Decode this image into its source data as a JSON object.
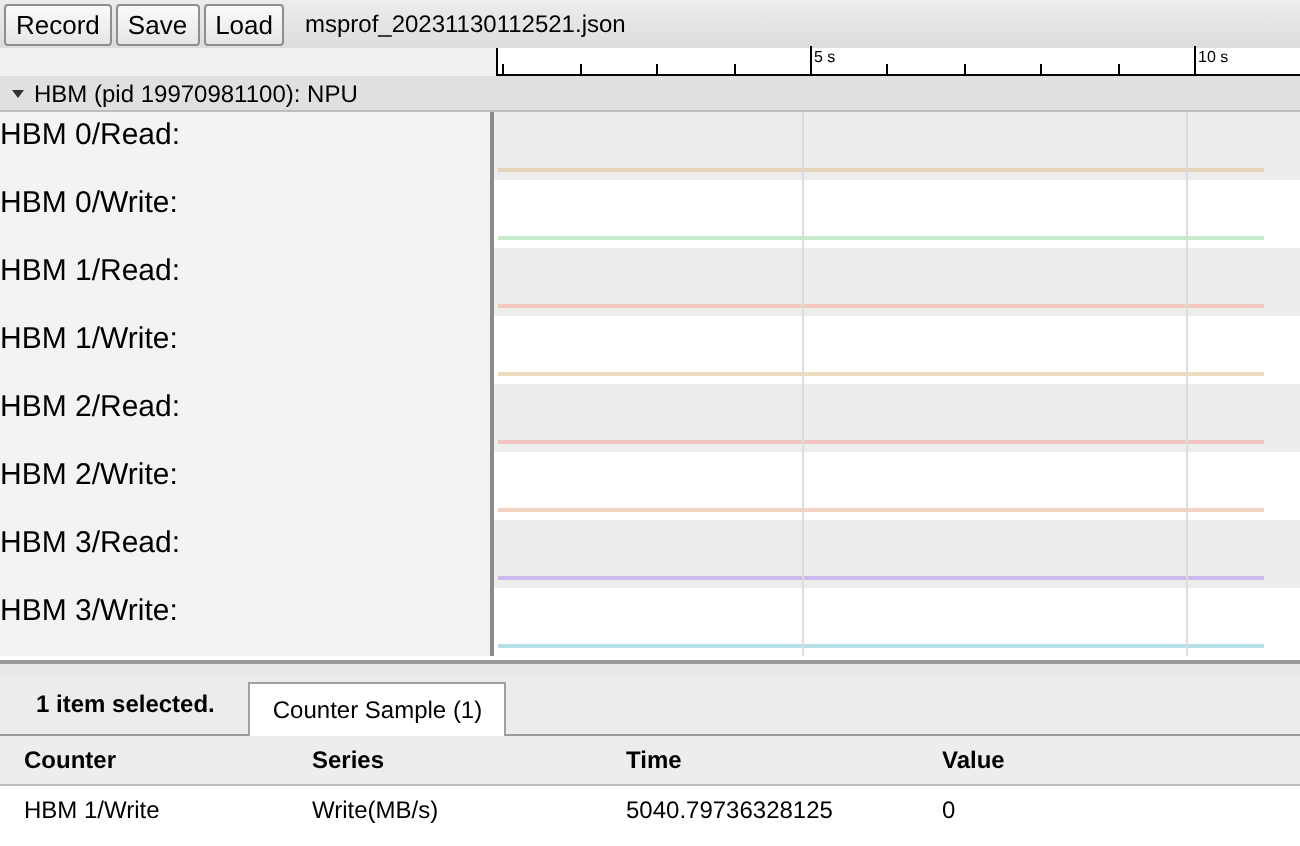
{
  "toolbar": {
    "buttons": [
      "Record",
      "Save",
      "Load"
    ],
    "filename": "msprof_20231130112521.json"
  },
  "ruler": {
    "ticks": [
      "5 s",
      "10 s"
    ]
  },
  "process": {
    "title": "HBM (pid 19970981100): NPU",
    "expanded": true
  },
  "tracks": [
    {
      "label": "HBM 0/Read:",
      "color": "#e8d4b8"
    },
    {
      "label": "HBM 0/Write:",
      "color": "#c5ebcb"
    },
    {
      "label": "HBM 1/Read:",
      "color": "#f2c8bc"
    },
    {
      "label": "HBM 1/Write:",
      "color": "#efdcbf"
    },
    {
      "label": "HBM 2/Read:",
      "color": "#f2c4c4"
    },
    {
      "label": "HBM 2/Write:",
      "color": "#f5d3c2"
    },
    {
      "label": "HBM 3/Read:",
      "color": "#cbb9ee"
    },
    {
      "label": "HBM 3/Write:",
      "color": "#b6dfe9"
    }
  ],
  "details": {
    "selection": "1 item selected.",
    "tabs": [
      {
        "label": "Counter Sample (1)",
        "selected": true
      }
    ],
    "columns": [
      "Counter",
      "Series",
      "Time",
      "Value"
    ],
    "rows": [
      [
        "HBM 1/Write",
        "Write(MB/s)",
        "5040.79736328125",
        "0"
      ]
    ]
  }
}
